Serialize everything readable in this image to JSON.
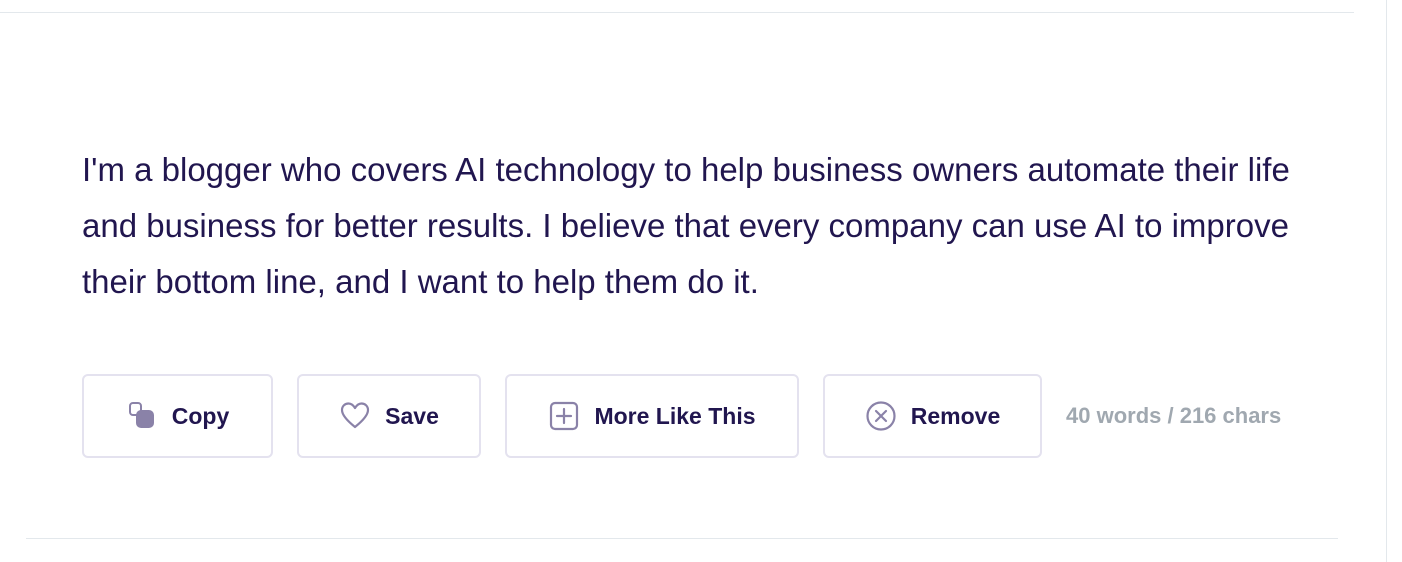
{
  "result": {
    "text": "I'm a blogger who covers AI technology to help business owners automate their life and business for better results. I believe that every company can use AI to improve their bottom line, and I want to help them do it."
  },
  "actions": {
    "copy": {
      "label": "Copy",
      "icon": "copy-icon"
    },
    "save": {
      "label": "Save",
      "icon": "heart-icon"
    },
    "more": {
      "label": "More Like This",
      "icon": "plus-square-icon"
    },
    "remove": {
      "label": "Remove",
      "icon": "x-circle-icon"
    }
  },
  "stats": {
    "count": "40 words / 216 chars"
  },
  "colors": {
    "text": "#21164f",
    "icon": "#8a82a8",
    "border": "#e4e2ef",
    "muted": "#a0a8b0"
  }
}
